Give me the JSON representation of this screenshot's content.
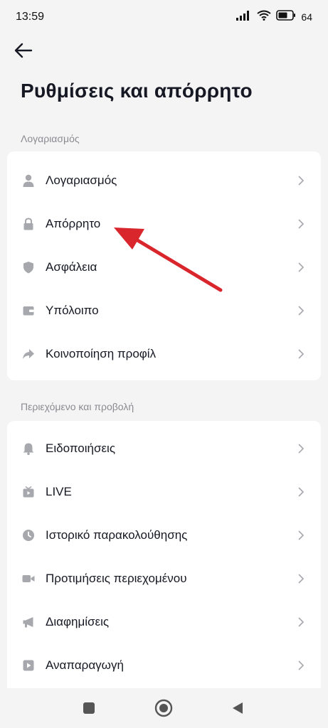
{
  "status_bar": {
    "time": "13:59",
    "battery": "64",
    "icons": [
      "signal-icon",
      "wifi-icon",
      "battery-icon"
    ]
  },
  "header": {
    "back_icon": "back-arrow-icon",
    "title": "Ρυθμίσεις και απόρρητο"
  },
  "sections": [
    {
      "label": "Λογαριασμός",
      "items": [
        {
          "label": "Λογαριασμός",
          "icon": "person-icon"
        },
        {
          "label": "Απόρρητο",
          "icon": "lock-icon"
        },
        {
          "label": "Ασφάλεια",
          "icon": "shield-icon"
        },
        {
          "label": "Υπόλοιπο",
          "icon": "wallet-icon"
        },
        {
          "label": "Κοινοποίηση προφίλ",
          "icon": "share-icon"
        }
      ]
    },
    {
      "label": "Περιεχόμενο και προβολή",
      "items": [
        {
          "label": "Ειδοποιήσεις",
          "icon": "bell-icon"
        },
        {
          "label": "LIVE",
          "icon": "live-tv-icon"
        },
        {
          "label": "Ιστορικό παρακολούθησης",
          "icon": "clock-icon"
        },
        {
          "label": "Προτιμήσεις περιεχομένου",
          "icon": "video-camera-icon"
        },
        {
          "label": "Διαφημίσεις",
          "icon": "megaphone-icon"
        },
        {
          "label": "Αναπαραγωγή",
          "icon": "play-icon"
        }
      ]
    }
  ],
  "colors": {
    "background": "#f4f4f4",
    "card": "#ffffff",
    "text": "#161823",
    "muted": "#8a8b91",
    "icon": "#a7a8ad",
    "annotation_arrow": "#d9252c"
  },
  "nav_bar": {
    "icons": [
      "recent-apps-icon",
      "home-icon",
      "back-triangle-icon"
    ]
  }
}
